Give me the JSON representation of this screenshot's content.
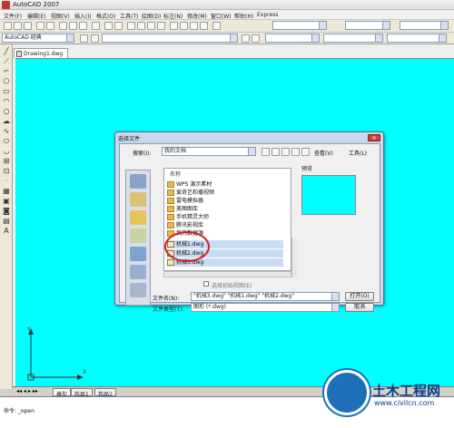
{
  "window": {
    "title": "AutoCAD 2007"
  },
  "menu": {
    "items": [
      "文件(F)",
      "编辑(E)",
      "视图(V)",
      "插入(I)",
      "格式(O)",
      "工具(T)",
      "绘图(D)",
      "标注(N)",
      "修改(M)",
      "窗口(W)",
      "帮助(H)",
      "Express"
    ]
  },
  "toolbar": {
    "workspace": "AutoCAD 经典"
  },
  "drawing": {
    "tab": "Drawing1.dwg"
  },
  "layout_tabs": [
    "模型",
    "布局1",
    "布局2"
  ],
  "command": {
    "prompt": "命令: _open"
  },
  "dialog": {
    "title": "选择文件",
    "lookin_label": "搜索(I):",
    "lookin_value": "我的文档",
    "views_label": "查看(V)",
    "tools_label": "工具(L)",
    "preview_label": "预览",
    "name_header": "名称",
    "files": [
      {
        "name": "WPS 演示素材",
        "type": "folder"
      },
      {
        "name": "爱奇艺和播视频",
        "type": "folder"
      },
      {
        "name": "雷电模拟器",
        "type": "folder"
      },
      {
        "name": "美图图库",
        "type": "folder"
      },
      {
        "name": "手机精灵大师",
        "type": "folder"
      },
      {
        "name": "腾讯影视库",
        "type": "folder"
      },
      {
        "name": "我的数据源",
        "type": "folder"
      },
      {
        "name": "机械1.dwg",
        "type": "dwg"
      },
      {
        "name": "机械2.dwg",
        "type": "dwg"
      },
      {
        "name": "机械3.dwg",
        "type": "dwg"
      }
    ],
    "partial_open_label": "选择初始视图(E)",
    "filename_label": "文件名(N):",
    "filename_value": "\"机械3.dwg\" \"机械1.dwg\" \"机械2.dwg\"",
    "filetype_label": "文件类型(T):",
    "filetype_value": "图形 (*.dwg)",
    "open_button": "打开(O)",
    "cancel_button": "取消"
  },
  "watermark": {
    "text": "土木工程网",
    "url": "www.civilcn.com"
  }
}
